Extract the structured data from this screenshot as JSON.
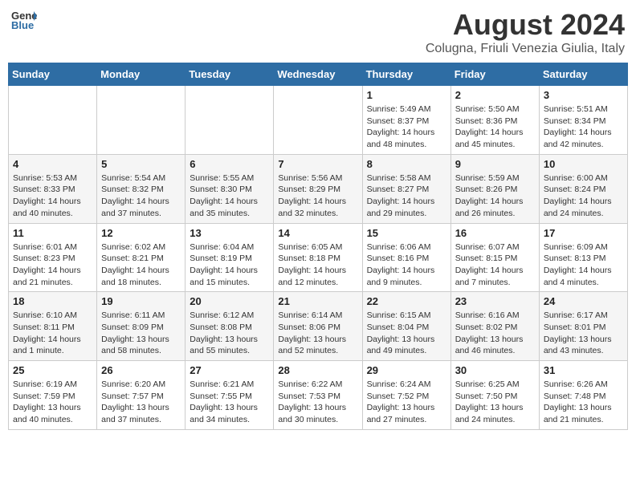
{
  "header": {
    "logo_line1": "General",
    "logo_line2": "Blue",
    "title": "August 2024",
    "subtitle": "Colugna, Friuli Venezia Giulia, Italy"
  },
  "days_of_week": [
    "Sunday",
    "Monday",
    "Tuesday",
    "Wednesday",
    "Thursday",
    "Friday",
    "Saturday"
  ],
  "weeks": [
    [
      {
        "day": "",
        "info": ""
      },
      {
        "day": "",
        "info": ""
      },
      {
        "day": "",
        "info": ""
      },
      {
        "day": "",
        "info": ""
      },
      {
        "day": "1",
        "info": "Sunrise: 5:49 AM\nSunset: 8:37 PM\nDaylight: 14 hours and 48 minutes."
      },
      {
        "day": "2",
        "info": "Sunrise: 5:50 AM\nSunset: 8:36 PM\nDaylight: 14 hours and 45 minutes."
      },
      {
        "day": "3",
        "info": "Sunrise: 5:51 AM\nSunset: 8:34 PM\nDaylight: 14 hours and 42 minutes."
      }
    ],
    [
      {
        "day": "4",
        "info": "Sunrise: 5:53 AM\nSunset: 8:33 PM\nDaylight: 14 hours and 40 minutes."
      },
      {
        "day": "5",
        "info": "Sunrise: 5:54 AM\nSunset: 8:32 PM\nDaylight: 14 hours and 37 minutes."
      },
      {
        "day": "6",
        "info": "Sunrise: 5:55 AM\nSunset: 8:30 PM\nDaylight: 14 hours and 35 minutes."
      },
      {
        "day": "7",
        "info": "Sunrise: 5:56 AM\nSunset: 8:29 PM\nDaylight: 14 hours and 32 minutes."
      },
      {
        "day": "8",
        "info": "Sunrise: 5:58 AM\nSunset: 8:27 PM\nDaylight: 14 hours and 29 minutes."
      },
      {
        "day": "9",
        "info": "Sunrise: 5:59 AM\nSunset: 8:26 PM\nDaylight: 14 hours and 26 minutes."
      },
      {
        "day": "10",
        "info": "Sunrise: 6:00 AM\nSunset: 8:24 PM\nDaylight: 14 hours and 24 minutes."
      }
    ],
    [
      {
        "day": "11",
        "info": "Sunrise: 6:01 AM\nSunset: 8:23 PM\nDaylight: 14 hours and 21 minutes."
      },
      {
        "day": "12",
        "info": "Sunrise: 6:02 AM\nSunset: 8:21 PM\nDaylight: 14 hours and 18 minutes."
      },
      {
        "day": "13",
        "info": "Sunrise: 6:04 AM\nSunset: 8:19 PM\nDaylight: 14 hours and 15 minutes."
      },
      {
        "day": "14",
        "info": "Sunrise: 6:05 AM\nSunset: 8:18 PM\nDaylight: 14 hours and 12 minutes."
      },
      {
        "day": "15",
        "info": "Sunrise: 6:06 AM\nSunset: 8:16 PM\nDaylight: 14 hours and 9 minutes."
      },
      {
        "day": "16",
        "info": "Sunrise: 6:07 AM\nSunset: 8:15 PM\nDaylight: 14 hours and 7 minutes."
      },
      {
        "day": "17",
        "info": "Sunrise: 6:09 AM\nSunset: 8:13 PM\nDaylight: 14 hours and 4 minutes."
      }
    ],
    [
      {
        "day": "18",
        "info": "Sunrise: 6:10 AM\nSunset: 8:11 PM\nDaylight: 14 hours and 1 minute."
      },
      {
        "day": "19",
        "info": "Sunrise: 6:11 AM\nSunset: 8:09 PM\nDaylight: 13 hours and 58 minutes."
      },
      {
        "day": "20",
        "info": "Sunrise: 6:12 AM\nSunset: 8:08 PM\nDaylight: 13 hours and 55 minutes."
      },
      {
        "day": "21",
        "info": "Sunrise: 6:14 AM\nSunset: 8:06 PM\nDaylight: 13 hours and 52 minutes."
      },
      {
        "day": "22",
        "info": "Sunrise: 6:15 AM\nSunset: 8:04 PM\nDaylight: 13 hours and 49 minutes."
      },
      {
        "day": "23",
        "info": "Sunrise: 6:16 AM\nSunset: 8:02 PM\nDaylight: 13 hours and 46 minutes."
      },
      {
        "day": "24",
        "info": "Sunrise: 6:17 AM\nSunset: 8:01 PM\nDaylight: 13 hours and 43 minutes."
      }
    ],
    [
      {
        "day": "25",
        "info": "Sunrise: 6:19 AM\nSunset: 7:59 PM\nDaylight: 13 hours and 40 minutes."
      },
      {
        "day": "26",
        "info": "Sunrise: 6:20 AM\nSunset: 7:57 PM\nDaylight: 13 hours and 37 minutes."
      },
      {
        "day": "27",
        "info": "Sunrise: 6:21 AM\nSunset: 7:55 PM\nDaylight: 13 hours and 34 minutes."
      },
      {
        "day": "28",
        "info": "Sunrise: 6:22 AM\nSunset: 7:53 PM\nDaylight: 13 hours and 30 minutes."
      },
      {
        "day": "29",
        "info": "Sunrise: 6:24 AM\nSunset: 7:52 PM\nDaylight: 13 hours and 27 minutes."
      },
      {
        "day": "30",
        "info": "Sunrise: 6:25 AM\nSunset: 7:50 PM\nDaylight: 13 hours and 24 minutes."
      },
      {
        "day": "31",
        "info": "Sunrise: 6:26 AM\nSunset: 7:48 PM\nDaylight: 13 hours and 21 minutes."
      }
    ]
  ]
}
